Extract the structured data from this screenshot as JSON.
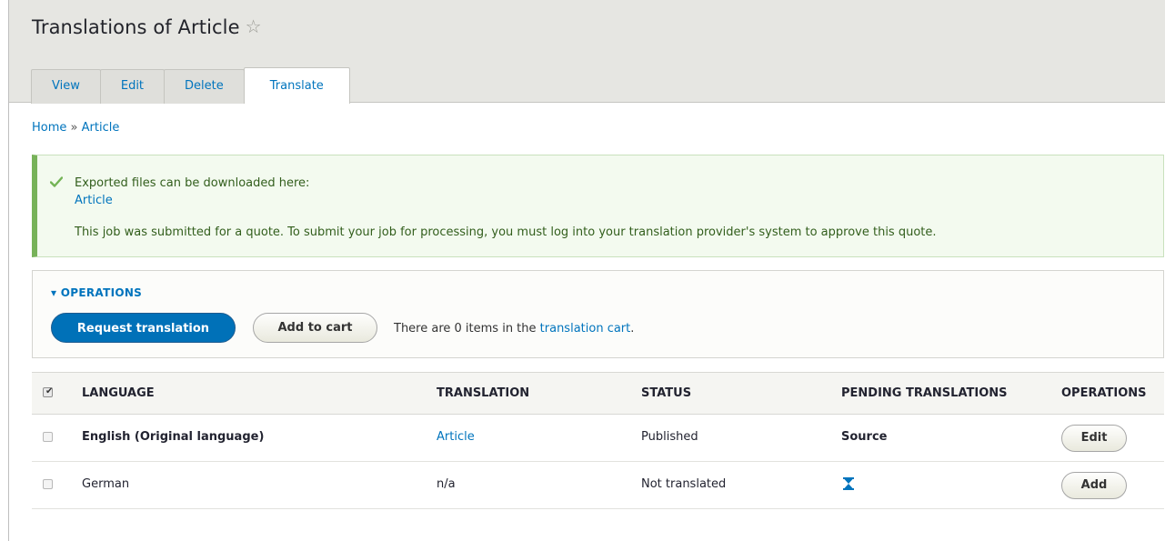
{
  "header": {
    "title": "Translations of Article",
    "star_icon": "star-outline-icon",
    "tabs": [
      {
        "label": "View",
        "active": false
      },
      {
        "label": "Edit",
        "active": false
      },
      {
        "label": "Delete",
        "active": false
      },
      {
        "label": "Translate",
        "active": true
      }
    ]
  },
  "breadcrumb": {
    "home": "Home",
    "separator": "»",
    "current": "Article"
  },
  "message": {
    "status": "success",
    "accent_color": "#77b259",
    "line1": "Exported files can be downloaded here:",
    "link": "Article",
    "line2": "This job was submitted for a quote. To submit your job for processing, you must log into your translation provider's system to approve this quote."
  },
  "operations": {
    "summary": "▾ OPERATIONS",
    "request_button": "Request translation",
    "cart_button": "Add to cart",
    "cart_text_prefix": "There are 0 items in the ",
    "cart_link": "translation cart",
    "cart_text_suffix": "."
  },
  "table": {
    "headers": {
      "language": "LANGUAGE",
      "translation": "TRANSLATION",
      "status": "STATUS",
      "pending": "PENDING TRANSLATIONS",
      "operations": "OPERATIONS"
    },
    "select_all_checked": true,
    "rows": [
      {
        "language": "English (Original language)",
        "translation": "Article",
        "status": "Published",
        "pending": "Source",
        "operation": "Edit"
      },
      {
        "language": "German",
        "translation": "n/a",
        "status": "Not translated",
        "pending_icon": "hourglass-icon",
        "operation": "Add"
      }
    ]
  },
  "colors": {
    "link": "#0074bd",
    "primary_button": "#0071b8",
    "header_bg": "#e6e6e2"
  }
}
